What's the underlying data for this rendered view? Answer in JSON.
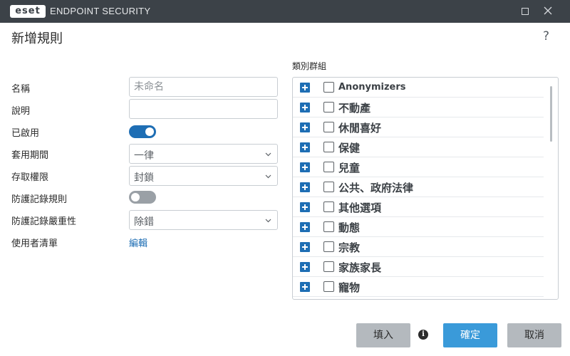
{
  "window": {
    "logo_text": "eset",
    "app_name": "ENDPOINT SECURITY",
    "maximize_icon": "maximize-icon",
    "close_icon": "close-icon"
  },
  "dialog": {
    "title": "新增規則",
    "help_glyph": "?"
  },
  "form": {
    "name_label": "名稱",
    "name_placeholder": "未命名",
    "description_label": "說明",
    "description_value": "",
    "enabled_label": "已啟用",
    "enabled": true,
    "period_label": "套用期間",
    "period_value": "一律",
    "access_label": "存取權限",
    "access_value": "封鎖",
    "log_rule_label": "防護記錄規則",
    "log_rule_enabled": false,
    "log_severity_label": "防護記錄嚴重性",
    "log_severity_value": "除錯",
    "user_list_label": "使用者清單",
    "user_list_link": "編輯"
  },
  "categories": {
    "label": "類別群組",
    "items": [
      {
        "label": "Anonymizers",
        "checked": false
      },
      {
        "label": "不動產",
        "checked": false
      },
      {
        "label": "休閒喜好",
        "checked": false
      },
      {
        "label": "保健",
        "checked": false
      },
      {
        "label": "兒童",
        "checked": false
      },
      {
        "label": "公共、政府法律",
        "checked": false
      },
      {
        "label": "其他選項",
        "checked": false
      },
      {
        "label": "動態",
        "checked": false
      },
      {
        "label": "宗教",
        "checked": false
      },
      {
        "label": "家族家長",
        "checked": false
      },
      {
        "label": "寵物",
        "checked": false
      }
    ]
  },
  "footer": {
    "import_label": "填入",
    "info_glyph": "i",
    "ok_label": "確定",
    "cancel_label": "取消"
  },
  "colors": {
    "titlebar": "#3c4248",
    "accent": "#1e6eb4",
    "primary_button": "#3a9ad9",
    "secondary_button": "#b4b9be"
  }
}
